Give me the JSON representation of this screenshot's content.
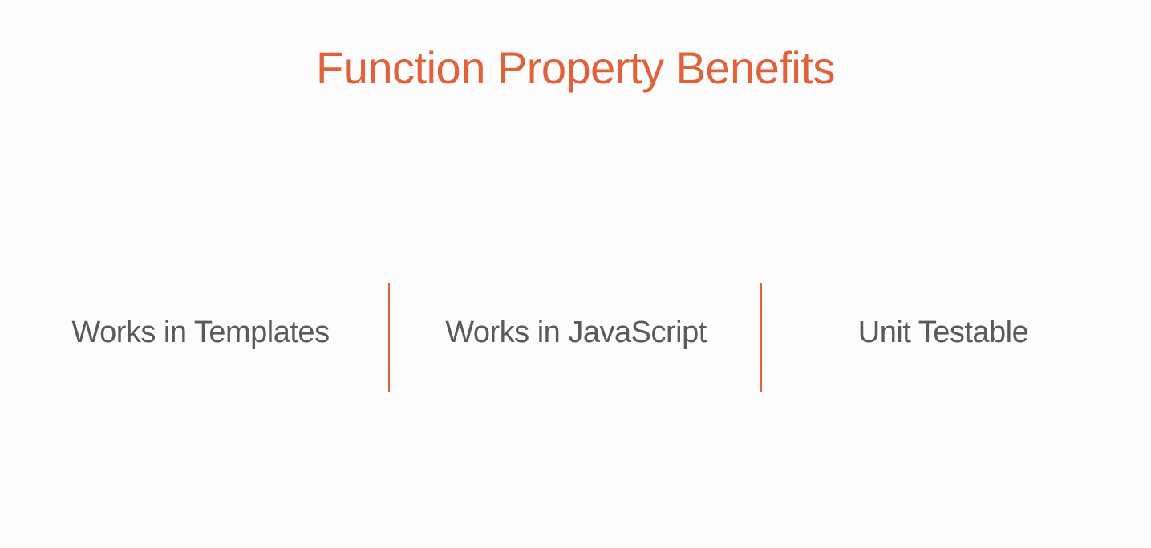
{
  "slide": {
    "title": "Function Property Benefits",
    "items": [
      {
        "label": "Works in Templates"
      },
      {
        "label": "Works in JavaScript"
      },
      {
        "label": "Unit Testable"
      }
    ]
  },
  "colors": {
    "accent": "#e0613a",
    "text": "#5a5a5c",
    "background": "#fdfcfc"
  }
}
